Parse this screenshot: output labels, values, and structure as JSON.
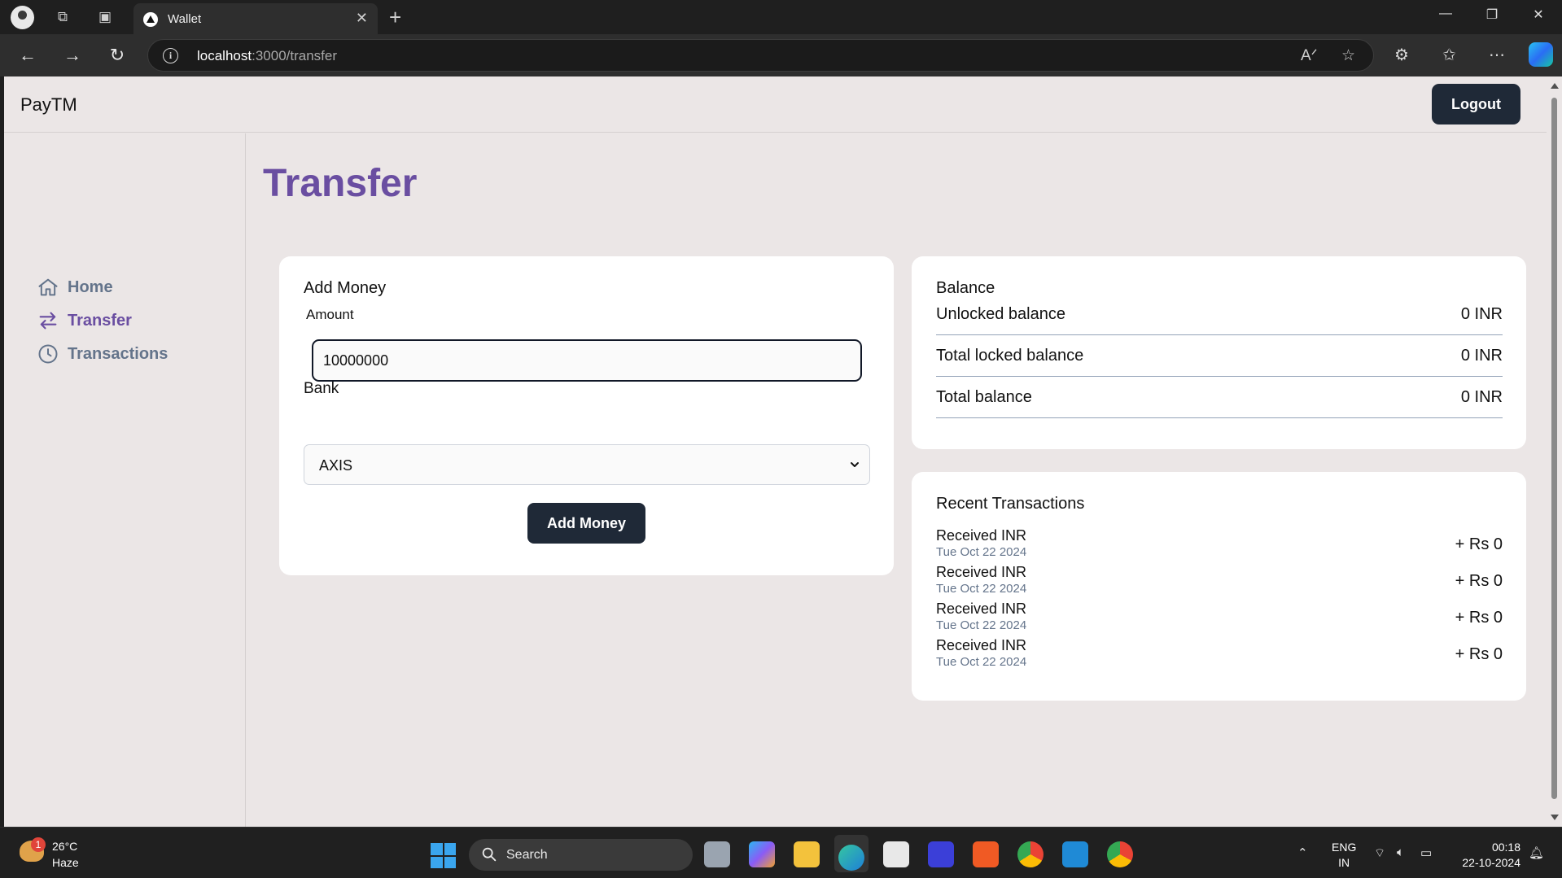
{
  "browser": {
    "tab_title": "Wallet",
    "url_host": "localhost",
    "url_path": ":3000/transfer"
  },
  "app": {
    "brand": "PayTM",
    "logout_label": "Logout"
  },
  "sidebar": {
    "items": [
      {
        "label": "Home",
        "icon": "home-icon",
        "active": false
      },
      {
        "label": "Transfer",
        "icon": "transfer-icon",
        "active": true
      },
      {
        "label": "Transactions",
        "icon": "clock-icon",
        "active": false
      }
    ]
  },
  "page": {
    "title": "Transfer"
  },
  "add_money": {
    "title": "Add Money",
    "amount_label": "Amount",
    "amount_value": "10000000",
    "bank_label": "Bank",
    "bank_selected": "AXIS",
    "button_label": "Add Money"
  },
  "balance": {
    "title": "Balance",
    "rows": [
      {
        "label": "Unlocked balance",
        "value": "0 INR"
      },
      {
        "label": "Total locked balance",
        "value": "0 INR"
      },
      {
        "label": "Total balance",
        "value": "0 INR"
      }
    ]
  },
  "recent": {
    "title": "Recent Transactions",
    "items": [
      {
        "title": "Received INR",
        "date": "Tue Oct 22 2024",
        "amount": "+ Rs 0"
      },
      {
        "title": "Received INR",
        "date": "Tue Oct 22 2024",
        "amount": "+ Rs 0"
      },
      {
        "title": "Received INR",
        "date": "Tue Oct 22 2024",
        "amount": "+ Rs 0"
      },
      {
        "title": "Received INR",
        "date": "Tue Oct 22 2024",
        "amount": "+ Rs 0"
      }
    ]
  },
  "taskbar": {
    "weather_badge": "1",
    "temperature": "26°C",
    "condition": "Haze",
    "search_label": "Search",
    "lang_line1": "ENG",
    "lang_line2": "IN",
    "time": "00:18",
    "date": "22-10-2024"
  },
  "colors": {
    "accent": "#6a4ea1",
    "button_dark": "#1f2937",
    "page_bg": "#ebe6e6",
    "muted_text": "#64748b"
  }
}
